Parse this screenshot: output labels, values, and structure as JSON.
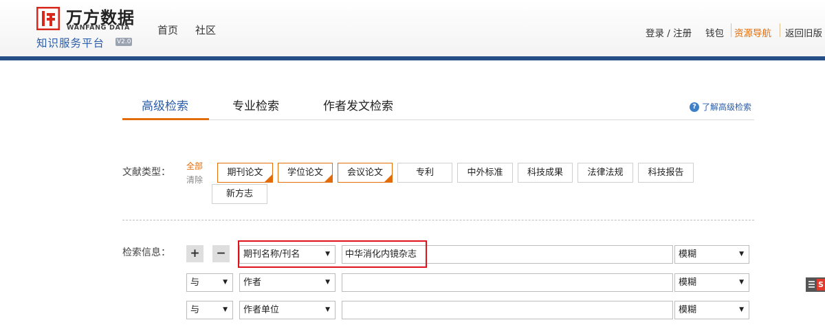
{
  "header": {
    "logo_cn": "万方数据",
    "logo_en": "WANFANG DATA",
    "platform_name": "知识服务平台",
    "version_badge": "V2.0",
    "nav": [
      "首页",
      "社区"
    ],
    "right_links": {
      "login_register": "登录 / 注册",
      "wallet": "钱包",
      "resource_nav": "资源导航",
      "back_old": "返回旧版"
    },
    "accent_color": "#e36c0a",
    "bar_color": "#254d86"
  },
  "tabs": {
    "items": [
      "高级检索",
      "专业检索",
      "作者发文检索"
    ],
    "active_index": 0,
    "help_link": "了解高级检索",
    "help_icon": "question-circle-icon"
  },
  "doc_types": {
    "label": "文献类型：",
    "all_link": "全部",
    "clear_link": "清除",
    "buttons": [
      {
        "label": "期刊论文",
        "selected": true
      },
      {
        "label": "学位论文",
        "selected": true
      },
      {
        "label": "会议论文",
        "selected": true
      },
      {
        "label": "专利",
        "selected": false
      },
      {
        "label": "中外标准",
        "selected": false
      },
      {
        "label": "科技成果",
        "selected": false
      },
      {
        "label": "法律法规",
        "selected": false
      },
      {
        "label": "科技报告",
        "selected": false
      },
      {
        "label": "新方志",
        "selected": false
      }
    ]
  },
  "search": {
    "label": "检索信息：",
    "add_label": "+",
    "remove_label": "−",
    "rows": [
      {
        "logic": "",
        "field": "期刊名称/刊名",
        "value": "中华消化内镜杂志",
        "match": "模糊"
      },
      {
        "logic": "与",
        "field": "作者",
        "value": "",
        "match": "模糊"
      },
      {
        "logic": "与",
        "field": "作者单位",
        "value": "",
        "match": "模糊"
      }
    ],
    "highlight_color": "#e0101a"
  },
  "side_widget": {
    "letter": "S"
  }
}
